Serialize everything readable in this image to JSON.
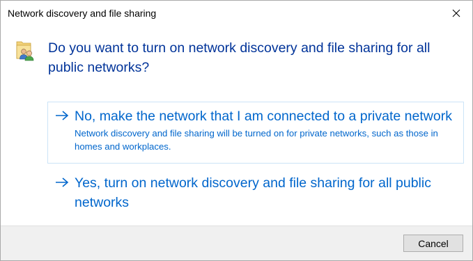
{
  "window": {
    "title": "Network discovery and file sharing"
  },
  "icons": {
    "close": "close-icon",
    "heading": "users-share-icon",
    "option_arrow": "arrow-right-icon"
  },
  "colors": {
    "question_text": "#003399",
    "link_text": "#0066cc",
    "selected_border": "#cce4f7",
    "footer_bg": "#f0f0f0"
  },
  "question": "Do you want to turn on network discovery and file sharing for all public networks?",
  "options": [
    {
      "title": "No, make the network that I am connected to a private network",
      "description": "Network discovery and file sharing will be turned on for private networks, such as those in homes and workplaces.",
      "selected": true
    },
    {
      "title": "Yes, turn on network discovery and file sharing for all public networks",
      "description": "",
      "selected": false
    }
  ],
  "footer": {
    "cancel_label": "Cancel"
  }
}
